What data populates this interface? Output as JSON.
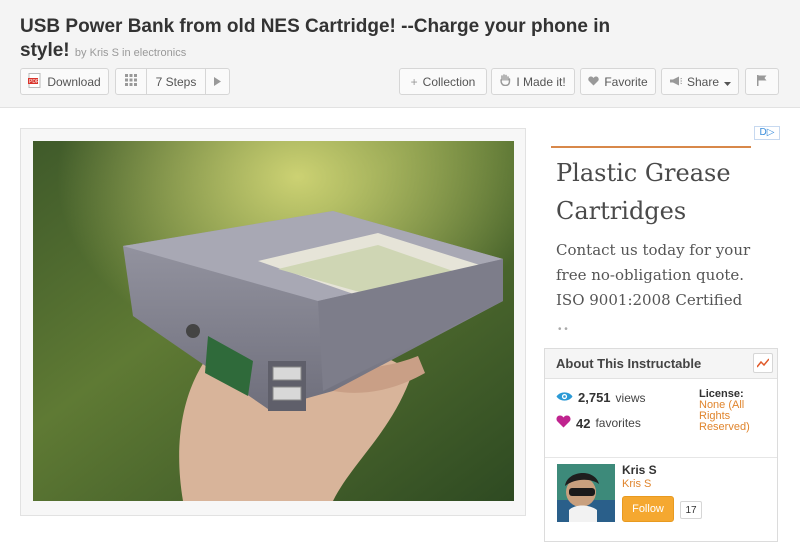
{
  "header": {
    "title": "USB Power Bank from old NES Cartridge! --Charge your phone in style!",
    "by": "by",
    "author": "Kris S",
    "in": "in",
    "category": "electronics"
  },
  "toolbar": {
    "download_label": "Download",
    "steps_label": "7 Steps",
    "collection_label": "Collection",
    "made_it_label": "I Made it!",
    "favorite_label": "Favorite",
    "share_label": "Share"
  },
  "ad": {
    "choices": "D▷",
    "title": "Plastic Grease Cartridges",
    "body": "Contact us today for your free no-obligation quote. ISO 9001:2008 Certified"
  },
  "about": {
    "heading": "About This Instructable",
    "views_count": "2,751",
    "views_label": "views",
    "favorites_count": "42",
    "favorites_label": "favorites",
    "license_label": "License:",
    "license_value": "None (All Rights Reserved)",
    "author_name": "Kris S",
    "author_sub": "Kris S",
    "follow_label": "Follow",
    "follow_count": "17"
  },
  "colors": {
    "accent": "#e0852d",
    "follow": "#f5a830",
    "views_icon": "#2b9ad6",
    "heart_icon": "#c0248f"
  }
}
